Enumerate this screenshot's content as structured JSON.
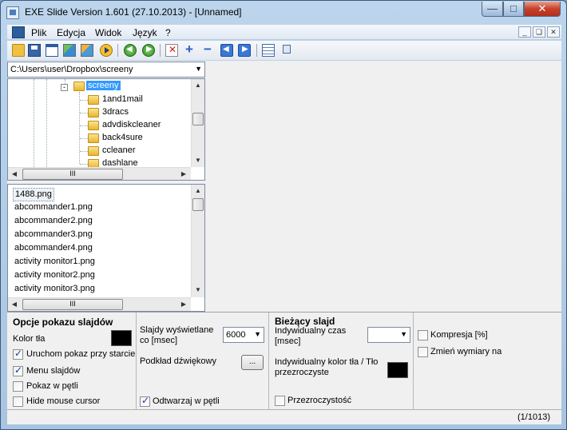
{
  "window": {
    "title": "EXE Slide Version 1.601 (27.10.2013) - [Unnamed]"
  },
  "menu": {
    "items": [
      "Plik",
      "Edycja",
      "Widok",
      "Język",
      "?"
    ]
  },
  "path": {
    "value": "C:\\Users\\user\\Dropbox\\screeny"
  },
  "tree": {
    "selected": "screeny",
    "children": [
      "1and1mail",
      "3dracs",
      "advdiskcleaner",
      "back4sure",
      "ccleaner",
      "dashlane"
    ]
  },
  "hscroll_grip": "III",
  "files": [
    "1488.png",
    "abcommander1.png",
    "abcommander2.png",
    "abcommander3.png",
    "abcommander4.png",
    "activity monitor1.png",
    "activity monitor2.png",
    "activity monitor3.png"
  ],
  "options": {
    "heading": "Opcje pokazu slajdów",
    "bg_color_label": "Kolor tła",
    "bg_color": "#000000",
    "start_on_launch": {
      "label": "Uruchom pokaz przy starcie",
      "checked": true
    },
    "slide_menu": {
      "label": "Menu slajdów",
      "checked": true
    },
    "loop_show": {
      "label": "Pokaz w pętli",
      "checked": false
    },
    "hide_cursor": {
      "label": "Hide mouse cursor",
      "checked": false
    },
    "slide_duration_label": "Slajdy wyświetlane co [msec]",
    "slide_duration_value": "6000",
    "sound_label": "Podkład dźwiękowy",
    "sound_button": "...",
    "play_loop": {
      "label": "Odtwarzaj w pętli",
      "checked": true
    }
  },
  "current_slide": {
    "heading": "Bieżący slajd",
    "individual_time_label": "Indywidualny czas [msec]",
    "individual_time_value": "",
    "individual_color_label": "Indywidualny kolor tła / Tło przezroczyste",
    "individual_color": "#000000",
    "transparency": {
      "label": "Przezroczystość",
      "checked": false
    }
  },
  "extra": {
    "compression": {
      "label": "Kompresja [%]",
      "checked": false
    },
    "resize": {
      "label": "Zmień wymiary na",
      "checked": false
    }
  },
  "status": {
    "count": "(1/1013)"
  }
}
